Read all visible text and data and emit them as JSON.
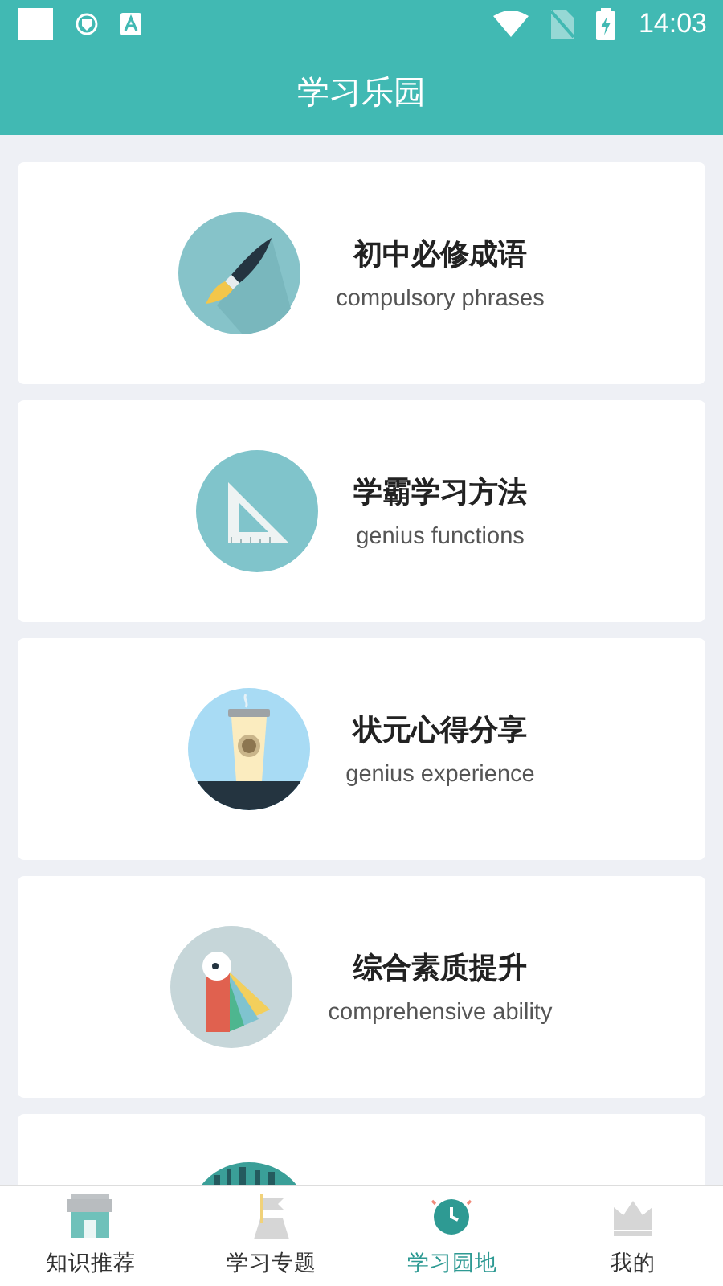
{
  "status_bar": {
    "time": "14:03"
  },
  "header": {
    "title": "学习乐园"
  },
  "cards": [
    {
      "title": "初中必修成语",
      "subtitle": "compulsory phrases"
    },
    {
      "title": "学霸学习方法",
      "subtitle": "genius functions"
    },
    {
      "title": "状元心得分享",
      "subtitle": "genius experience"
    },
    {
      "title": "综合素质提升",
      "subtitle": "comprehensive ability"
    }
  ],
  "nav": [
    {
      "label": "知识推荐",
      "selected": false
    },
    {
      "label": "学习专题",
      "selected": false
    },
    {
      "label": "学习园地",
      "selected": true
    },
    {
      "label": "我的",
      "selected": false
    }
  ]
}
